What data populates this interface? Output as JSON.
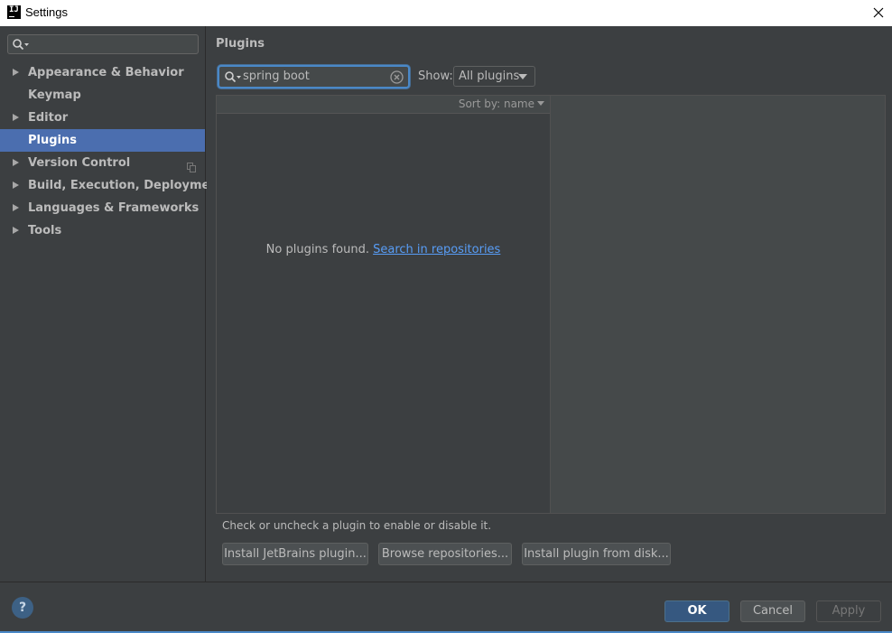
{
  "window": {
    "title": "Settings",
    "app_icon_text": "IJ"
  },
  "sidebar": {
    "search_placeholder": "",
    "items": [
      {
        "label": "Appearance & Behavior",
        "expandable": true
      },
      {
        "label": "Keymap",
        "expandable": false
      },
      {
        "label": "Editor",
        "expandable": true
      },
      {
        "label": "Plugins",
        "expandable": false,
        "selected": true
      },
      {
        "label": "Version Control",
        "expandable": true,
        "has_copy_icon": true
      },
      {
        "label": "Build, Execution, Deployment",
        "expandable": true
      },
      {
        "label": "Languages & Frameworks",
        "expandable": true
      },
      {
        "label": "Tools",
        "expandable": true
      }
    ]
  },
  "main": {
    "title": "Plugins",
    "search": {
      "value": "spring boot"
    },
    "show": {
      "label": "Show:",
      "selected": "All plugins"
    },
    "list": {
      "sort_label": "Sort by: name",
      "empty_text": "No plugins found.",
      "empty_link": "Search in repositories"
    },
    "hint": "Check or uncheck a plugin to enable or disable it.",
    "buttons": {
      "install_jetbrains": "Install JetBrains plugin...",
      "browse": "Browse repositories...",
      "install_disk": "Install plugin from disk..."
    }
  },
  "footer": {
    "help": "?",
    "ok": "OK",
    "cancel": "Cancel",
    "apply": "Apply"
  },
  "colors": {
    "background": "#3c3f41",
    "selection": "#4b6eaf",
    "focus_border": "#4a88c7",
    "link": "#589df6",
    "ok_button": "#365880"
  }
}
